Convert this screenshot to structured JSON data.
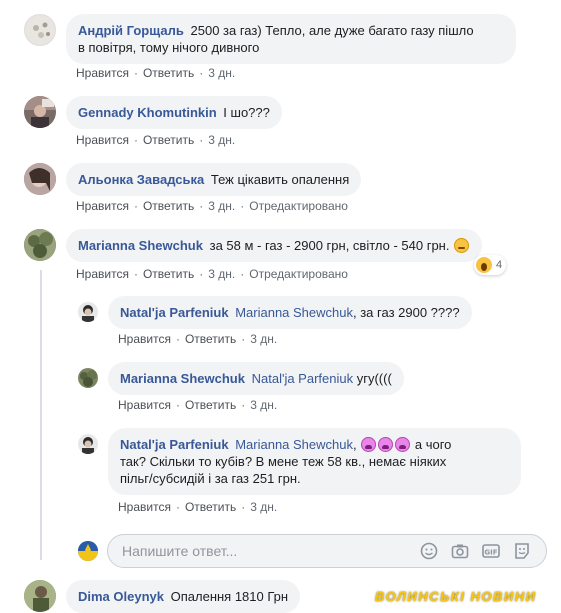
{
  "actions": {
    "like": "Нравится",
    "reply": "Ответить",
    "edited": "Отредактировано"
  },
  "comments": [
    {
      "author": "Андрій Горщаль",
      "text_line1": "2500 за газ) Тепло, але дуже багато газу пішло",
      "text_line2": "в повітря, тому нічого дивного",
      "time": "3 дн."
    },
    {
      "author": "Gennady Khomutinkin",
      "text": "І шо???",
      "time": "3 дн."
    },
    {
      "author": "Альонка Завадська",
      "text": "Теж цікавить опалення",
      "time": "3 дн."
    },
    {
      "author": "Marianna Shewchuk",
      "text": "за 58 м - газ - 2900 грн, світло - 540 грн.",
      "time": "3 дн.",
      "reaction_count": "4"
    },
    {
      "author": "Dima Oleynyk",
      "text": "Опалення 1810 Грн"
    }
  ],
  "replies": [
    {
      "author": "Natal'ja Parfeniuk",
      "tag": "Marianna Shewchuk",
      "text": ", за газ 2900 ????",
      "time": "3 дн."
    },
    {
      "author": "Marianna Shewchuk",
      "tag": "Natal'ja Parfeniuk",
      "text": "угу((((",
      "time": "3 дн."
    },
    {
      "author": "Natal'ja Parfeniuk",
      "tag": "Marianna Shewchuk",
      "text_after_tag": ",",
      "text_line1_end": "а чого",
      "text_line2": "так? Скільки то кубів? В мене теж 58 кв., немає ніяких",
      "text_line3": "пільг/субсидій і за газ 251 грн.",
      "time": "3 дн."
    }
  ],
  "reply_box": {
    "placeholder": "Напишите ответ..."
  },
  "watermark": "ВОЛИНСЬКІ НОВИНИ",
  "colors": {
    "author": "#385898",
    "bubble": "#f2f3f5",
    "meta": "#606770"
  }
}
